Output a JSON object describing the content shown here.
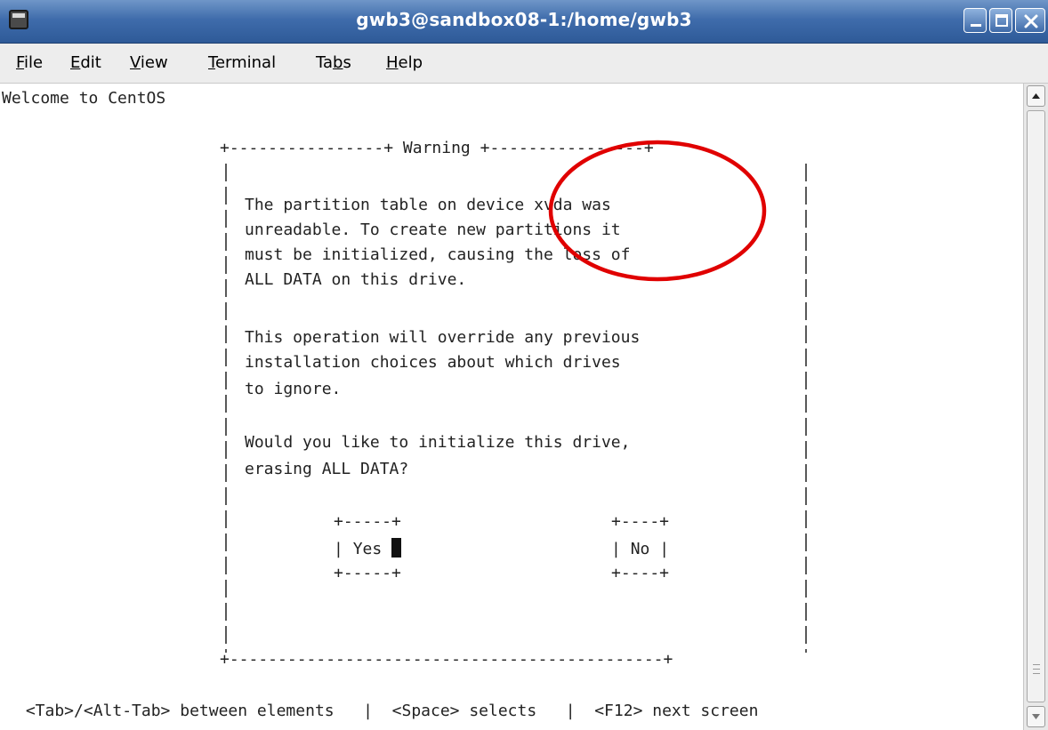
{
  "window": {
    "title": "gwb3@sandbox08-1:/home/gwb3"
  },
  "menu": {
    "items": [
      {
        "label": "File",
        "accel": "F",
        "rest": "ile"
      },
      {
        "label": "Edit",
        "accel": "E",
        "rest": "dit"
      },
      {
        "label": "View",
        "accel": "V",
        "rest": "iew"
      },
      {
        "label": "Terminal",
        "accel": "T",
        "rest": "erminal"
      },
      {
        "label": "Tabs",
        "pre": "Ta",
        "accel": "b",
        "rest": "s"
      },
      {
        "label": "Help",
        "accel": "H",
        "rest": "elp"
      }
    ]
  },
  "terminal": {
    "welcome": "Welcome to CentOS",
    "dialog": {
      "title": "Warning",
      "top_border_left": "+----------------+ ",
      "top_border_right": " +----------------+",
      "message_lines": [
        "The partition table on device xvda was",
        "unreadable. To create new partitions it",
        "must be initialized, causing the loss of",
        "ALL DATA on this drive.",
        "",
        "This operation will override any previous",
        "installation choices about which drives",
        "to ignore.",
        "",
        "Would you like to initialize this drive,",
        "erasing ALL DATA?"
      ],
      "buttons": {
        "yes": "Yes",
        "no": "No"
      },
      "bottom_border": "+---------------------------------------------+"
    },
    "status_line": " <Tab>/<Alt-Tab> between elements   |  <Space> selects   |  <F12> next screen"
  },
  "annotation": {
    "shape": "red ellipse",
    "color": "#e00000"
  },
  "colors": {
    "titlebar": "#3f6cab",
    "menubar": "#ededed",
    "terminal_bg": "#ffffff",
    "terminal_fg": "#222222"
  }
}
